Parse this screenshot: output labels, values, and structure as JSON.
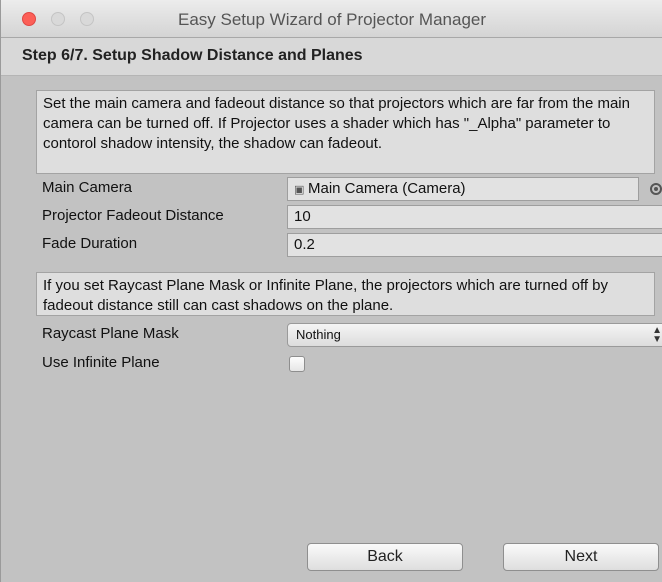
{
  "window": {
    "title": "Easy Setup Wizard of Projector Manager"
  },
  "step": {
    "title": "Step 6/7. Setup Shadow Distance and Planes"
  },
  "help1": {
    "text": "Set the main camera and fadeout distance so that projectors which are far from the main camera can be turned off. If Projector uses a shader which has \"_Alpha\" parameter to contorol shadow intensity, the shadow can fadeout."
  },
  "fields": {
    "main_camera_label": "Main Camera",
    "main_camera_value": "Main Camera (Camera)",
    "fadeout_distance_label": "Projector Fadeout Distance",
    "fadeout_distance_value": "10",
    "fade_duration_label": "Fade Duration",
    "fade_duration_value": "0.2"
  },
  "help2": {
    "text": "If you set Raycast Plane Mask or Infinite Plane, the projectors which are turned off by fadeout distance still can cast shadows on the plane."
  },
  "raycast": {
    "label": "Raycast Plane Mask",
    "selected": "Nothing"
  },
  "infinite_plane": {
    "label": "Use Infinite Plane",
    "checked": false
  },
  "buttons": {
    "back": "Back",
    "next": "Next"
  },
  "icons": {
    "camera": "camera-icon",
    "picker": "object-picker-icon",
    "dropdown": "up-down-arrow-icon"
  },
  "colors": {
    "close_light": "#fc5f57",
    "background": "#c2c2c2",
    "helpbox": "#dedede"
  }
}
